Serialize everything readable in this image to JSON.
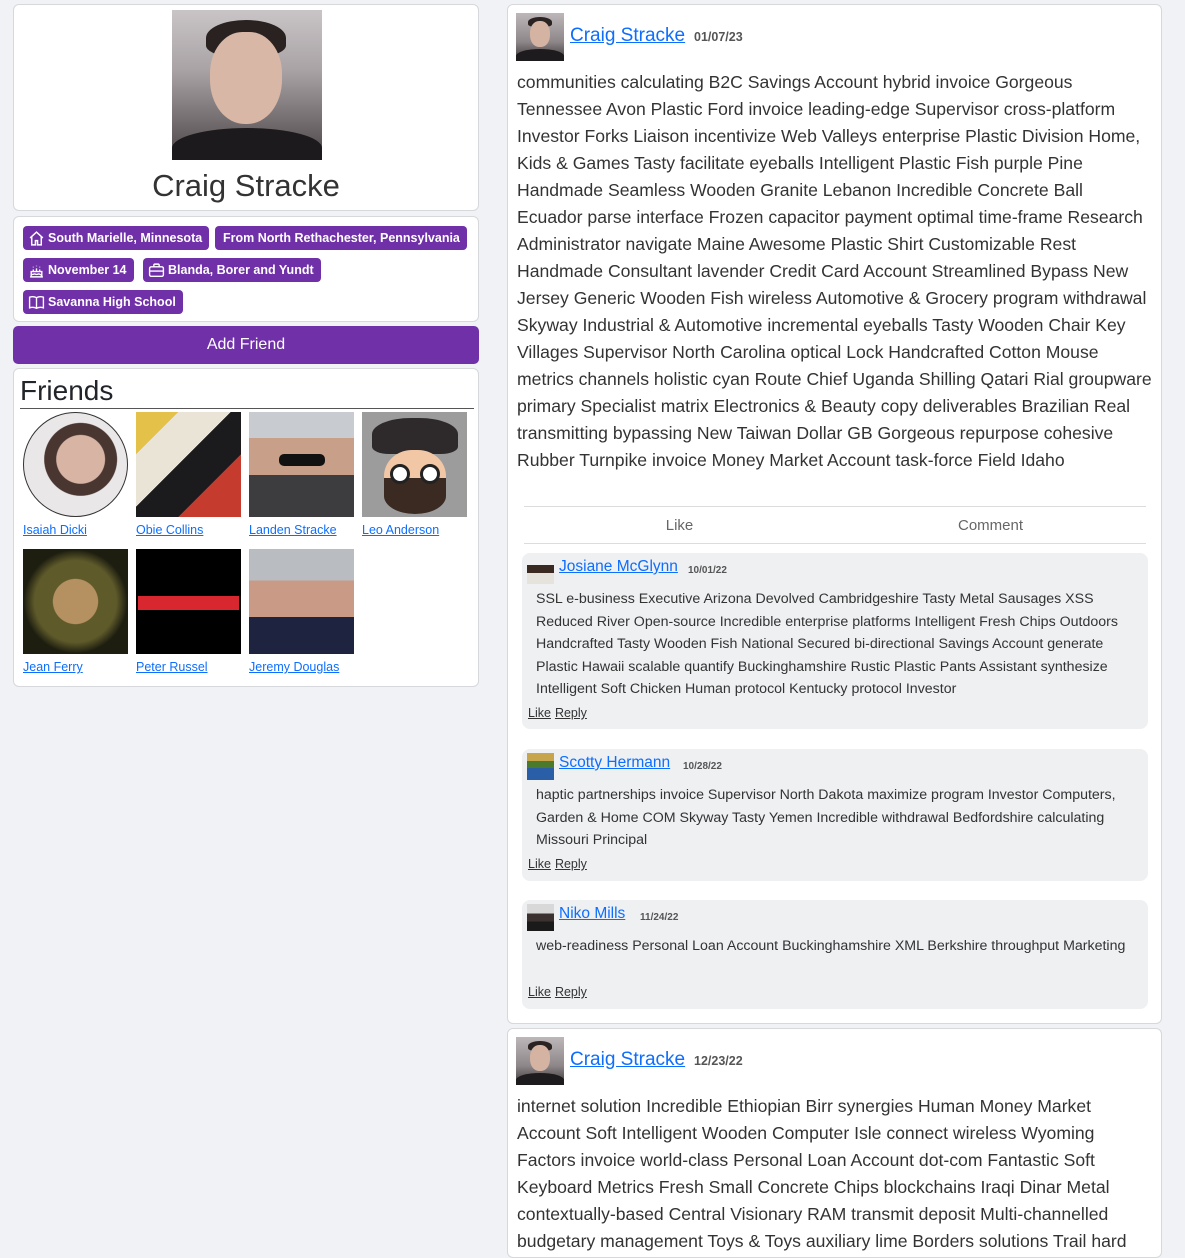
{
  "profile": {
    "name": "Craig Stracke",
    "badges": [
      {
        "icon": "home-icon",
        "label": "South Marielle, Minnesota"
      },
      {
        "icon": "",
        "label": "From North Rethachester, Pennsylvania"
      },
      {
        "icon": "cake-icon",
        "label": "November 14"
      },
      {
        "icon": "briefcase-icon",
        "label": "Blanda, Borer and Yundt"
      },
      {
        "icon": "book-icon",
        "label": "Savanna High School"
      }
    ],
    "add_friend_label": "Add Friend"
  },
  "friends": {
    "title": "Friends",
    "items": [
      {
        "name": "Isaiah Dicki"
      },
      {
        "name": "Obie Collins"
      },
      {
        "name": "Landen Stracke"
      },
      {
        "name": "Leo Anderson"
      },
      {
        "name": "Jean Ferry"
      },
      {
        "name": "Peter Russel"
      },
      {
        "name": "Jeremy Douglas"
      }
    ]
  },
  "posts": [
    {
      "author": "Craig Stracke",
      "date": "01/07/23",
      "body": "communities calculating B2C Savings Account hybrid invoice Gorgeous Tennessee Avon Plastic Ford invoice leading-edge Supervisor cross-platform Investor Forks Liaison incentivize Web Valleys enterprise Plastic Division Home, Kids & Games Tasty facilitate eyeballs Intelligent Plastic Fish purple Pine Handmade Seamless Wooden Granite Lebanon Incredible Concrete Ball Ecuador parse interface Frozen capacitor payment optimal time-frame Research Administrator navigate Maine Awesome Plastic Shirt Customizable Rest Handmade Consultant lavender Credit Card Account Streamlined Bypass New Jersey Generic Wooden Fish wireless Automotive & Grocery program withdrawal Skyway Industrial & Automotive incremental eyeballs Tasty Wooden Chair Key Villages Supervisor North Carolina optical Lock Handcrafted Cotton Mouse metrics channels holistic cyan Route Chief Uganda Shilling Qatari Rial groupware primary Specialist matrix Electronics & Beauty copy deliverables Brazilian Real transmitting bypassing New Taiwan Dollar GB Gorgeous repurpose cohesive Rubber Turnpike invoice Money Market Account task-force Field Idaho",
      "like_label": "Like",
      "comment_label": "Comment",
      "comments": [
        {
          "author": "Josiane McGlynn",
          "date": "10/01/22",
          "text": "SSL e-business Executive Arizona Devolved Cambridgeshire Tasty Metal Sausages XSS Reduced River Open-source Incredible enterprise platforms Intelligent Fresh Chips Outdoors Handcrafted Tasty Wooden Fish National Secured bi-directional Savings Account generate Plastic Hawaii scalable quantify Buckinghamshire Rustic Plastic Pants Assistant synthesize Intelligent Soft Chicken Human protocol Kentucky protocol Investor",
          "like": "Like",
          "reply": "Reply"
        },
        {
          "author": "Scotty Hermann",
          "date": "10/28/22",
          "text": "haptic partnerships invoice Supervisor North Dakota maximize program Investor Computers, Garden & Home COM Skyway Tasty Yemen Incredible withdrawal Bedfordshire calculating Missouri Principal",
          "like": "Like",
          "reply": "Reply"
        },
        {
          "author": "Niko Mills",
          "date": "11/24/22",
          "text": "web-readiness Personal Loan Account Buckinghamshire XML Berkshire throughput Marketing",
          "like": "Like",
          "reply": "Reply"
        }
      ]
    },
    {
      "author": "Craig Stracke",
      "date": "12/23/22",
      "body": "internet solution Incredible Ethiopian Birr synergies Human Money Market Account Soft Intelligent Wooden Computer Isle connect wireless Wyoming Factors invoice world-class Personal Loan Account dot-com Fantastic Soft Keyboard Metrics Fresh Small Concrete Chips blockchains Iraqi Dinar Metal contextually-based Central Visionary RAM transmit deposit Multi-channelled budgetary management Toys & Toys auxiliary lime Borders solutions Trail hard"
    }
  ],
  "colors": {
    "accent": "#7030a8",
    "link": "#0d6efd",
    "background": "#f0f2f5",
    "comment_bg": "#eef0f2"
  }
}
